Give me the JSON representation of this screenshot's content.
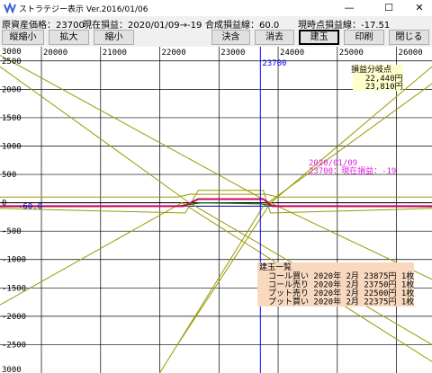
{
  "window": {
    "title": "ストラテジー表示 Ver.2016/01/06",
    "minimize": "—",
    "maximize": "☐",
    "close": "✕"
  },
  "info": {
    "asset": "原資産価格：23700",
    "pnl": "現在損益：2020/01/09→-19",
    "combined": "合成損益線：60.0",
    "spot": "現時点損益線：-17.51"
  },
  "toolbar": {
    "zoom_v": "縦縮小",
    "expand": "拡大",
    "shrink": "縮小",
    "settle": "決含",
    "erase": "消去",
    "position": "建玉",
    "print": "印刷",
    "close": "閉じる"
  },
  "chart_data": {
    "type": "line",
    "title": "",
    "x_ticks": [
      "20000",
      "21000",
      "22000",
      "23000",
      "24000",
      "25000",
      "26000"
    ],
    "y_ticks": [
      "2500",
      "2000",
      "1500",
      "1000",
      "500",
      "0",
      "-500",
      "-1000",
      "-1500",
      "-2000",
      "-2500"
    ],
    "top_clip": "3000",
    "bottom_clip": "3000",
    "xlim": [
      19300,
      26600
    ],
    "ylim": [
      -3000,
      2750
    ],
    "current_price": 23700,
    "current_price_label": "23700",
    "level_label": "-60.0",
    "level_value": -60,
    "colors": {
      "combined": "#cc0066",
      "options": "#999900",
      "current": "#007700",
      "price_line": "#0000ff",
      "level_line": "#0000aa"
    },
    "combined_payoff": [
      [
        19300,
        -60
      ],
      [
        22400,
        -60
      ],
      [
        22650,
        65
      ],
      [
        23750,
        65
      ],
      [
        23900,
        -60
      ],
      [
        26600,
        -60
      ]
    ],
    "legs": [
      {
        "name": "コール買い",
        "strike": 23875
      },
      {
        "name": "コール売り",
        "strike": 23750
      },
      {
        "name": "プット売り",
        "strike": 22500
      },
      {
        "name": "プット買い",
        "strike": 22375
      }
    ],
    "breakeven_title": "損益分岐点",
    "breakeven_values": [
      "22,440円",
      "23,810円"
    ],
    "current_note_date": "2020/01/09",
    "current_note_text": "23700：現在損益：-19",
    "position_title": "建玉一覧",
    "positions": [
      "コール買い 2020年 2月 23875円 1枚",
      "コール売り 2020年 2月 23750円 1枚",
      "プット売り 2020年 2月 22500円 1枚",
      "プット買い 2020年 2月 22375円 1枚"
    ]
  }
}
